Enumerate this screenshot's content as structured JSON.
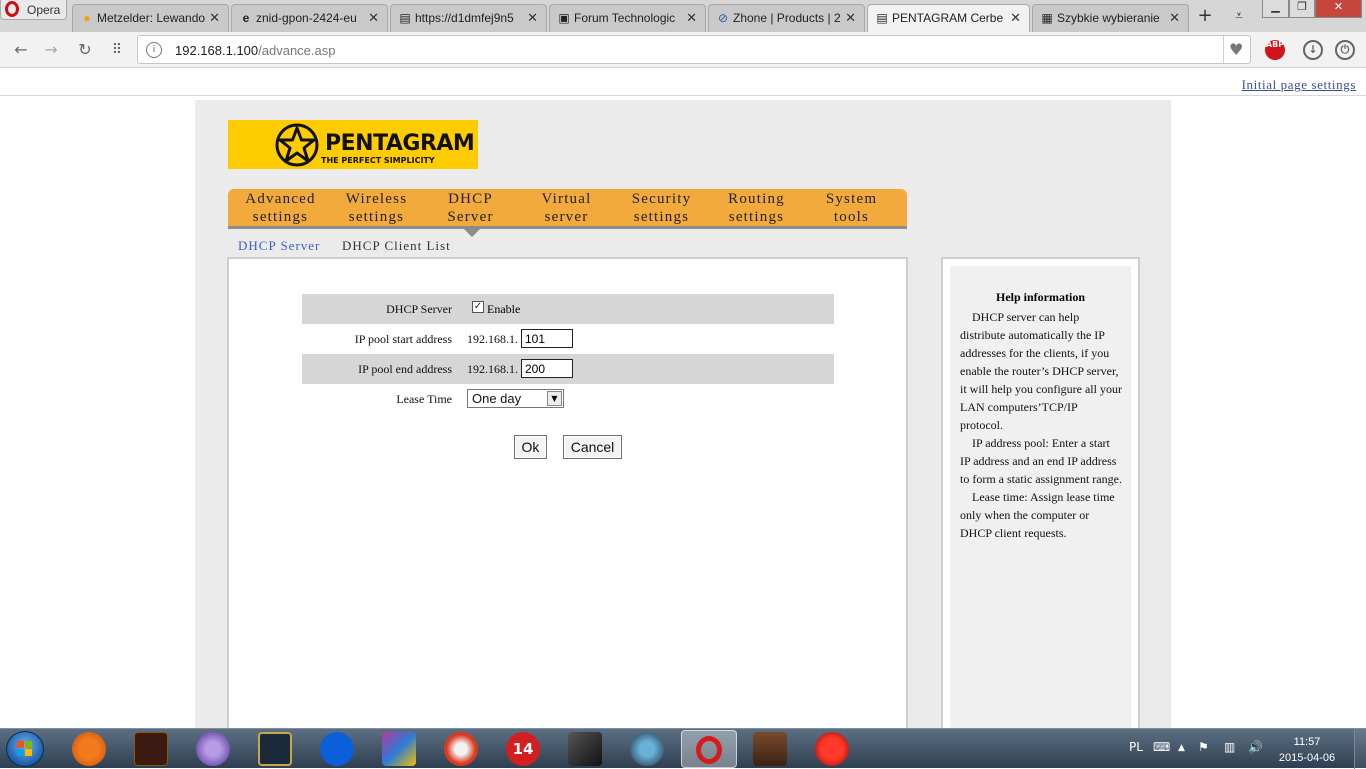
{
  "browser": {
    "menu_label": "Opera",
    "tabs": [
      {
        "title": "Metzelder: Lewando",
        "icon": "orange-circle-icon"
      },
      {
        "title": "znid-gpon-2424-eu",
        "icon": "e-icon"
      },
      {
        "title": "https://d1dmfej9n5",
        "icon": "page-icon"
      },
      {
        "title": "Forum Technologic",
        "icon": "forum-icon"
      },
      {
        "title": "Zhone | Products | 2",
        "icon": "zhone-icon"
      },
      {
        "title": "PENTAGRAM Cerbe",
        "icon": "page-icon"
      },
      {
        "title": "Szybkie wybieranie",
        "icon": "speed-dial-icon"
      }
    ],
    "url_host": "192.168.1.100",
    "url_path": "/advance.asp",
    "abp_label": "ABP"
  },
  "page": {
    "initial_settings_link": "Initial page settings",
    "logo": {
      "brand": "PENTAGRAM",
      "tagline": "THE PERFECT SIMPLICITY"
    },
    "menu": [
      {
        "line1": "Advanced",
        "line2": "settings"
      },
      {
        "line1": "Wireless",
        "line2": "settings"
      },
      {
        "line1": "DHCP",
        "line2": "Server"
      },
      {
        "line1": "Virtual",
        "line2": "server"
      },
      {
        "line1": "Security",
        "line2": "settings"
      },
      {
        "line1": "Routing",
        "line2": "settings"
      },
      {
        "line1": "System",
        "line2": "tools"
      }
    ],
    "submenu": {
      "active": "DHCP Server",
      "other": "DHCP Client List"
    },
    "form": {
      "dhcp_server_label": "DHCP Server",
      "enable_label": "Enable",
      "enable_checked": true,
      "pool_start_label": "IP pool start address",
      "pool_start_prefix": "192.168.1.",
      "pool_start_value": "101",
      "pool_end_label": "IP pool end address",
      "pool_end_prefix": "192.168.1.",
      "pool_end_value": "200",
      "lease_time_label": "Lease Time",
      "lease_time_value": "One day",
      "ok_label": "Ok",
      "cancel_label": "Cancel"
    },
    "help": {
      "title": "Help information",
      "p1": "DHCP server can help distribute automatically the IP addresses for the clients, if you enable the router’s DHCP server, it will help you configure all your LAN computers’TCP/IP protocol.",
      "p2": "IP address pool: Enter a start IP address and an end IP address to form a static assignment range.",
      "p3": "Lease time: Assign lease time only when the computer or DHCP client requests."
    }
  },
  "taskbar": {
    "language": "PL",
    "time": "11:57",
    "date": "2015-04-06",
    "badge_number": "14"
  },
  "colors": {
    "menu_orange": "#f2aa3d",
    "logo_yellow": "#ffcc00",
    "active_submenu": "#3a5fcd",
    "link_blue": "#3a4d9c"
  }
}
